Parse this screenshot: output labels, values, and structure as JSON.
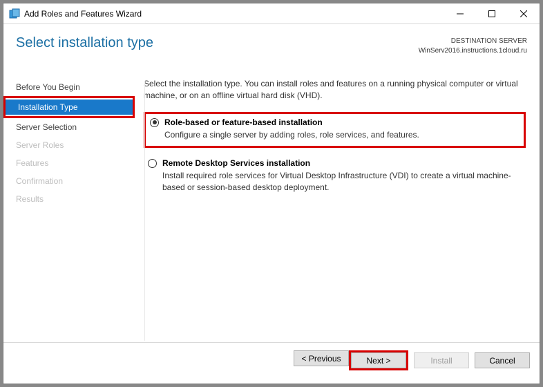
{
  "window": {
    "title": "Add Roles and Features Wizard"
  },
  "header": {
    "page_title": "Select installation type",
    "dest_label": "DESTINATION SERVER",
    "dest_name": "WinServ2016.instructions.1cloud.ru"
  },
  "sidebar": {
    "items": [
      {
        "label": "Before You Begin",
        "state": "normal"
      },
      {
        "label": "Installation Type",
        "state": "active"
      },
      {
        "label": "Server Selection",
        "state": "normal"
      },
      {
        "label": "Server Roles",
        "state": "disabled"
      },
      {
        "label": "Features",
        "state": "disabled"
      },
      {
        "label": "Confirmation",
        "state": "disabled"
      },
      {
        "label": "Results",
        "state": "disabled"
      }
    ]
  },
  "content": {
    "intro": "Select the installation type. You can install roles and features on a running physical computer or virtual machine, or on an offline virtual hard disk (VHD).",
    "opt1": {
      "title": "Role-based or feature-based installation",
      "desc": "Configure a single server by adding roles, role services, and features."
    },
    "opt2": {
      "title": "Remote Desktop Services installation",
      "desc": "Install required role services for Virtual Desktop Infrastructure (VDI) to create a virtual machine-based or session-based desktop deployment."
    }
  },
  "footer": {
    "previous": "< Previous",
    "next": "Next >",
    "install": "Install",
    "cancel": "Cancel"
  }
}
